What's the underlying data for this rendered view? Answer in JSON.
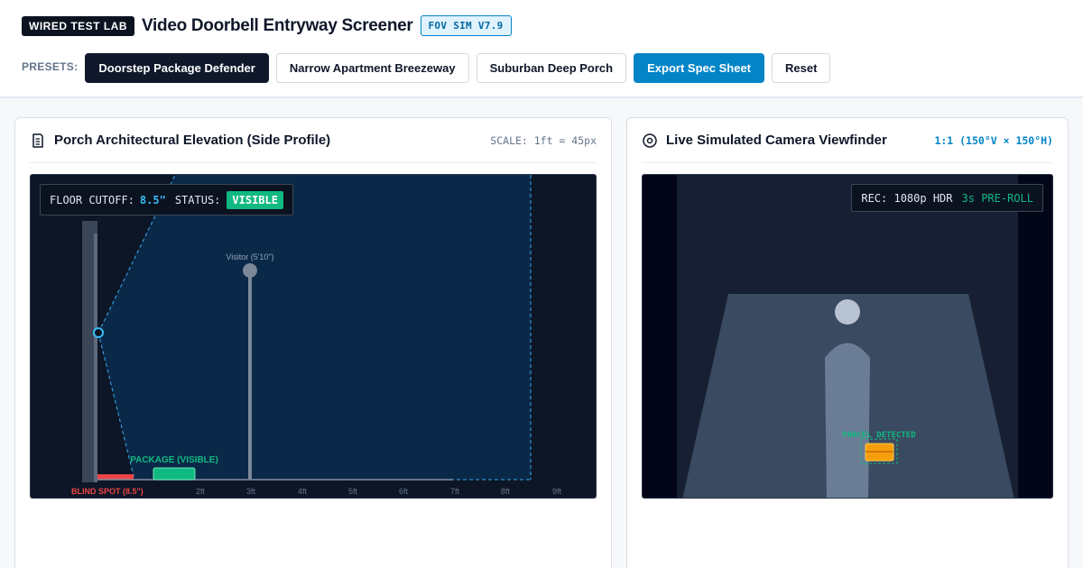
{
  "header": {
    "lab_badge": "WIRED TEST LAB",
    "title": "Video Doorbell Entryway Screener",
    "version": "FOV SIM V7.9"
  },
  "presets": {
    "label": "PRESETS:",
    "buttons": [
      {
        "label": "Doorstep Package Defender",
        "state": "active"
      },
      {
        "label": "Narrow Apartment Breezeway",
        "state": "default"
      },
      {
        "label": "Suburban Deep Porch",
        "state": "default"
      },
      {
        "label": "Export Spec Sheet",
        "state": "primary"
      },
      {
        "label": "Reset",
        "state": "default"
      }
    ]
  },
  "elevation_panel": {
    "title": "Porch Architectural Elevation (Side Profile)",
    "scale": "SCALE: 1ft = 45px",
    "icon": "document-icon",
    "floor_cutoff_label": "FLOOR CUTOFF:",
    "floor_cutoff_value": "8.5\"",
    "status_label": "STATUS:",
    "status_value": "VISIBLE",
    "visitor_label": "Visitor (5'10\")",
    "package_label": "PACKAGE (VISIBLE)",
    "blind_spot_label": "BLIND SPOT (8.5\")",
    "distance_ticks": [
      "2ft",
      "3ft",
      "4ft",
      "5ft",
      "6ft",
      "7ft",
      "8ft",
      "9ft"
    ]
  },
  "viewfinder_panel": {
    "title": "Live Simulated Camera Viewfinder",
    "fov": "1:1 (150°V × 150°H)",
    "icon": "target-icon",
    "rec_label": "REC: 1080p HDR",
    "preroll": "3s PRE-ROLL",
    "parcel_label": "PARCEL DETECTED"
  },
  "colors": {
    "accent": "#0284c7",
    "visible": "#10b981",
    "blind_spot": "#ef4444",
    "parcel": "#f59e0b"
  }
}
